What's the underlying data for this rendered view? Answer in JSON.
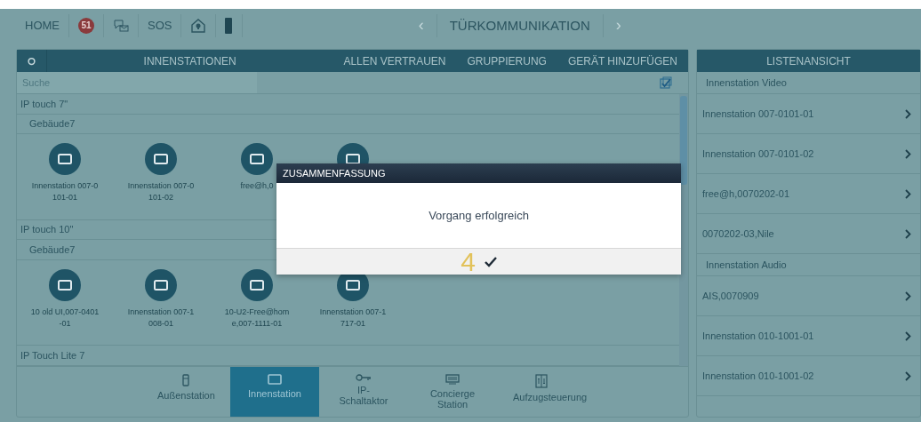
{
  "top_bar": {
    "home": "HOME",
    "badge": "51",
    "sos": "SOS",
    "back": "‹",
    "title": "TÜRKOMMUNIKATION",
    "forward": "›"
  },
  "left_panel": {
    "header_tabs": [
      "INNENSTATIONEN",
      "ALLEN VERTRAUEN",
      "GRUPPIERUNG",
      "GERÄT HINZUFÜGEN"
    ],
    "search": {
      "placeholder": "Suche"
    },
    "select_all": {
      "checked": true
    },
    "groups": [
      {
        "title": "IP touch 7\"",
        "subgroups": [
          {
            "title": "Gebäude7",
            "devices": [
              {
                "kind": "indoor",
                "lines": [
                  "Innenstation 007-0",
                  "101-01"
                ]
              },
              {
                "kind": "indoor",
                "lines": [
                  "Innenstation 007-0",
                  "101-02"
                ]
              },
              {
                "kind": "indoor",
                "lines": [
                  "free@h,0"
                ]
              },
              {
                "kind": "indoor"
              }
            ]
          }
        ]
      },
      {
        "title": "IP touch 10\"",
        "subgroups": [
          {
            "title": "Gebäude7",
            "devices": [
              {
                "kind": "indoor",
                "lines": [
                  "10 old UI,007-0401",
                  "-01"
                ]
              },
              {
                "kind": "indoor",
                "lines": [
                  "Innenstation 007-1",
                  "008-01"
                ]
              },
              {
                "kind": "indoor",
                "lines": [
                  "10-U2-Free@hom",
                  "e,007-1111-01"
                ]
              },
              {
                "kind": "indoor",
                "lines": [
                  "Innenstation 007-1",
                  "717-01"
                ]
              }
            ]
          }
        ]
      },
      {
        "title": "IP Touch Lite 7"
      }
    ],
    "bottom_tabs": [
      {
        "kind": "outdoor",
        "label": "Außenstation",
        "selected": false
      },
      {
        "kind": "indoor",
        "label": "Innenstation",
        "selected": true
      },
      {
        "kind": "actuator",
        "label": "IP-Schaltaktor",
        "selected": false
      },
      {
        "kind": "concierge",
        "label": "Concierge Station",
        "selected": false
      },
      {
        "kind": "elevator",
        "label": "Aufzugsteuerung",
        "selected": false
      }
    ]
  },
  "right_panel": {
    "title": "LISTENANSICHT",
    "sections": [
      {
        "title": "Innenstation Video",
        "items": [
          "Innenstation 007-0101-01",
          "Innenstation 007-0101-02",
          "free@h,0070202-01",
          "0070202-03,Nile"
        ]
      },
      {
        "title": "Innenstation Audio",
        "items": [
          "AIS,0070909",
          "Innenstation 010-1001-01",
          "Innenstation 010-1001-02"
        ]
      }
    ]
  },
  "dialog": {
    "title": "ZUSAMMENFASSUNG",
    "message": "Vorgang erfolgreich",
    "annotation": "4"
  }
}
